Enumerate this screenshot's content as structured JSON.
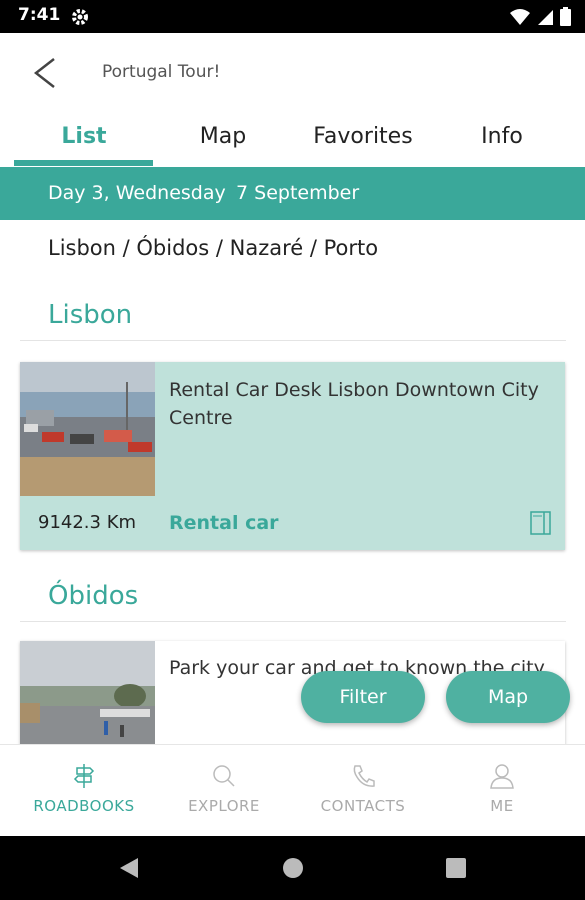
{
  "status": {
    "time": "7:41"
  },
  "app": {
    "title": "Portugal Tour!"
  },
  "tabs": [
    {
      "label": "List"
    },
    {
      "label": "Map"
    },
    {
      "label": "Favorites"
    },
    {
      "label": "Info"
    }
  ],
  "day": {
    "label": "Day 3, Wednesday",
    "date": "7 September"
  },
  "route": "Lisbon / Óbidos / Nazaré / Porto",
  "sections": [
    {
      "title": "Lisbon",
      "card": {
        "description": "Rental Car Desk Lisbon Downtown City Centre",
        "distance": "9142.3 Km",
        "category": "Rental car"
      }
    },
    {
      "title": "Óbidos",
      "card": {
        "description": "Park your car and get to known the city"
      }
    }
  ],
  "fab": {
    "filter": "Filter",
    "map": "Map"
  },
  "bottom_nav": [
    {
      "label": "ROADBOOKS",
      "icon": "signpost-icon"
    },
    {
      "label": "EXPLORE",
      "icon": "search-icon"
    },
    {
      "label": "CONTACTS",
      "icon": "phone-icon"
    },
    {
      "label": "ME",
      "icon": "person-icon"
    }
  ],
  "colors": {
    "accent": "#3aa89a",
    "card_bg": "#bfe1da",
    "fab": "#4fb1a1"
  }
}
